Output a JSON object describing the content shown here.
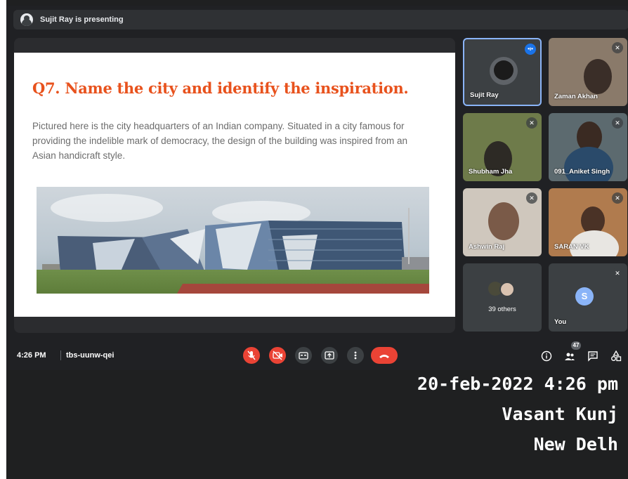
{
  "presenter_banner": {
    "text": "Sujit Ray is presenting"
  },
  "slide": {
    "title": "Q7. Name the city and identify the inspiration.",
    "body": "Pictured here is the city headquarters of an Indian company. Situated in a city famous for providing the indelible mark of democracy, the design of the building was inspired from an Asian handicraft style."
  },
  "participants": [
    {
      "name": "Sujit Ray",
      "status": "speaking"
    },
    {
      "name": "Zaman Akhan",
      "status": "muted"
    },
    {
      "name": "Shubham Jha",
      "status": "muted"
    },
    {
      "name": "091_Aniket Singh",
      "status": "muted"
    },
    {
      "name": "Ashwin Raj",
      "status": "muted"
    },
    {
      "name": "SARAN VK",
      "status": "muted"
    },
    {
      "name": "39 others",
      "status": ""
    },
    {
      "name": "You",
      "initial": "S",
      "status": "muted"
    }
  ],
  "bottom_bar": {
    "time": "4:26 PM",
    "meeting_code": "tbs-uunw-qei",
    "people_count": "47"
  },
  "overlay": {
    "line1": "20-feb-2022 4:26 pm",
    "line2": "Vasant Kunj",
    "line3": "New Delh"
  },
  "colors": {
    "accent": "#e8521d",
    "end_call": "#ea4335",
    "active_border": "#8ab4f8"
  }
}
